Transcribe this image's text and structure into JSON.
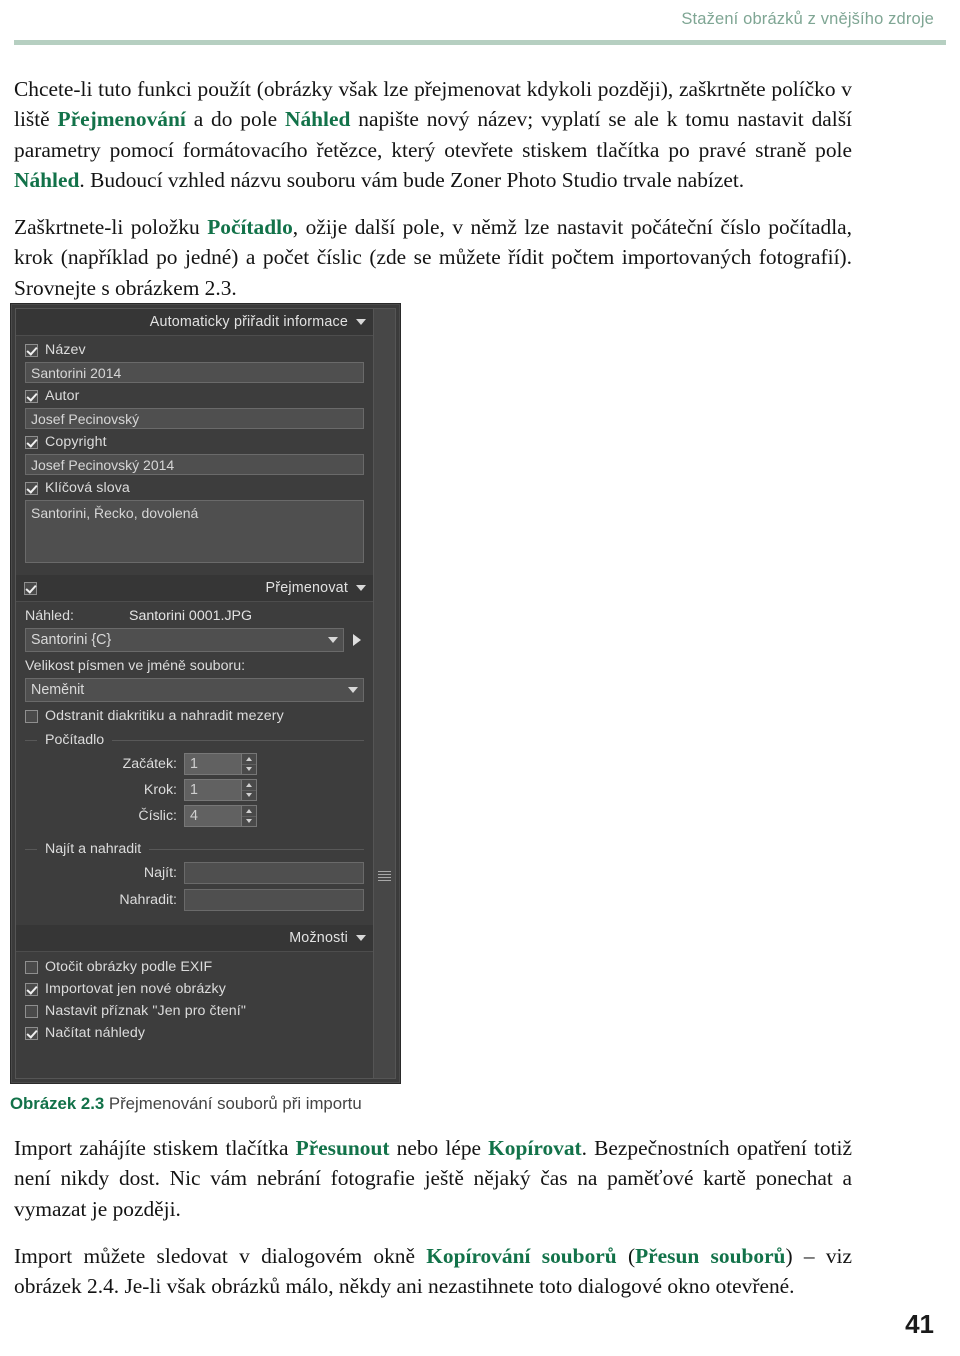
{
  "page": {
    "running_head": "Stažení obrázků z vnějšího zdroje",
    "folio": "41",
    "accent_green": "#127249",
    "rule_green": "#b6cfc1",
    "head_text_green": "#7fa694"
  },
  "paragraphs": {
    "p1_a": "Chcete-li tuto funkci použít (obrázky však lze přejmenovat kdykoli později), zaškrtněte políčko v liště ",
    "p1_kw1": "Přejmenování",
    "p1_b": " a do pole ",
    "p1_kw2": "Náhled",
    "p1_c": " napište nový název; vyplatí se ale k tomu nastavit další parametry pomocí formátovacího řetězce, který otevřete stiskem tlačítka po pravé straně pole ",
    "p1_kw3": "Náhled",
    "p1_d": ". Budoucí vzhled názvu souboru vám bude Zoner Photo Studio trvale nabízet.",
    "p2_a": "Zaškrtnete-li položku ",
    "p2_kw1": "Počítadlo",
    "p2_b": ", ožije další pole, v němž lze nastavit počáteční číslo počítadla, krok (například po jedné) a počet číslic (zde se můžete řídit počtem importovaných fotografií). Srovnejte s obrázkem 2.3.",
    "p3_a": "Import zahájíte stiskem tlačítka ",
    "p3_kw1": "Přesunout",
    "p3_b": " nebo lépe ",
    "p3_kw2": "Kopírovat",
    "p3_c": ". Bezpečnostních opatření totiž není nikdy dost. Nic vám nebrání fotografie ještě nějaký čas na paměťové kartě ponechat a vymazat je později.",
    "p4_a": "Import můžete sledovat v dialogovém okně ",
    "p4_kw1": "Kopírování souborů",
    "p4_b": " (",
    "p4_kw2": "Přesun souborů",
    "p4_c": ") – viz obrázek 2.4. Je-li však obrázků málo, někdy ani nezastihnete toto dialogové okno otevřené."
  },
  "caption": {
    "number": "Obrázek 2.3",
    "text": "Přejmenování souborů při importu"
  },
  "dialog": {
    "section_auto": {
      "title": "Automaticky přiřadit informace",
      "fields": [
        {
          "checkbox_label": "Název",
          "checked": true,
          "value": "Santorini 2014"
        },
        {
          "checkbox_label": "Autor",
          "checked": true,
          "value": "Josef Pecinovský"
        },
        {
          "checkbox_label": "Copyright",
          "checked": true,
          "value": "Josef Pecinovský 2014"
        },
        {
          "checkbox_label": "Klíčová slova",
          "checked": true,
          "value": "Santorini, Řecko, dovolená"
        }
      ]
    },
    "section_rename": {
      "title": "Přejmenovat",
      "enabled": true,
      "preview_label": "Náhled:",
      "preview_value": "Santorini 0001.JPG",
      "format_string": "Santorini {C}",
      "case_label": "Velikost písmen ve jméně souboru:",
      "case_value": "Neměnit",
      "diacritics_label": "Odstranit diakritiku a nahradit mezery",
      "diacritics_checked": false,
      "counter": {
        "group_title": "Počítadlo",
        "rows": [
          {
            "label": "Začátek:",
            "value": "1"
          },
          {
            "label": "Krok:",
            "value": "1"
          },
          {
            "label": "Číslic:",
            "value": "4"
          }
        ]
      },
      "find_replace": {
        "group_title": "Najít a nahradit",
        "find_label": "Najít:",
        "find_value": "",
        "replace_label": "Nahradit:",
        "replace_value": ""
      }
    },
    "section_options": {
      "title": "Možnosti",
      "items": [
        {
          "label": "Otočit obrázky podle EXIF",
          "checked": false
        },
        {
          "label": "Importovat jen nové obrázky",
          "checked": true
        },
        {
          "label": "Nastavit příznak \"Jen pro čtení\"",
          "checked": false
        },
        {
          "label": "Načítat náhledy",
          "checked": true
        }
      ]
    }
  }
}
